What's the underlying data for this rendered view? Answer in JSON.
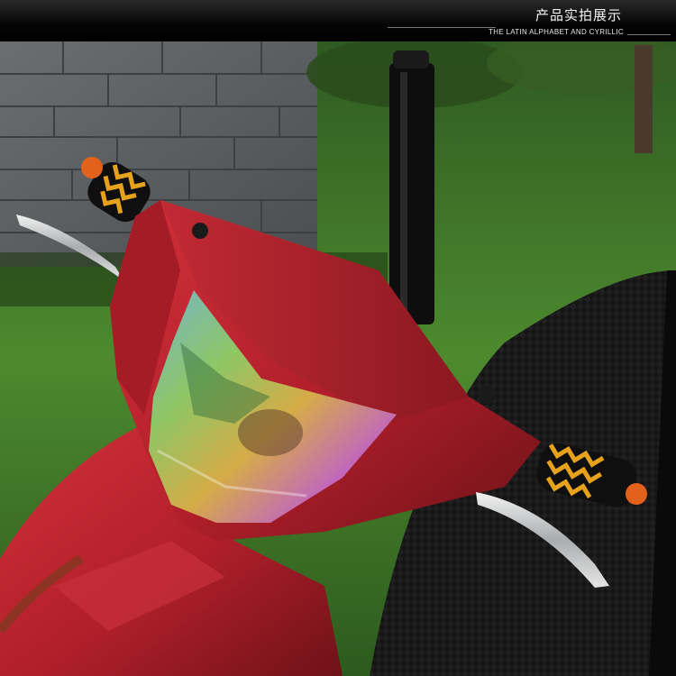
{
  "banner": {
    "title": "产品实拍展示",
    "subtitle": "THE LATIN ALPHABET AND CYRILLIC"
  },
  "photo": {
    "subject": "scooter-handlebar-headlight",
    "colors": {
      "body_red": "#b8202b",
      "grass_green": "#3f7a2a",
      "wall_gray": "#5f6264",
      "seat_black": "#141414",
      "grip_yellow": "#e6a21d",
      "accent_orange": "#e2621c"
    }
  }
}
